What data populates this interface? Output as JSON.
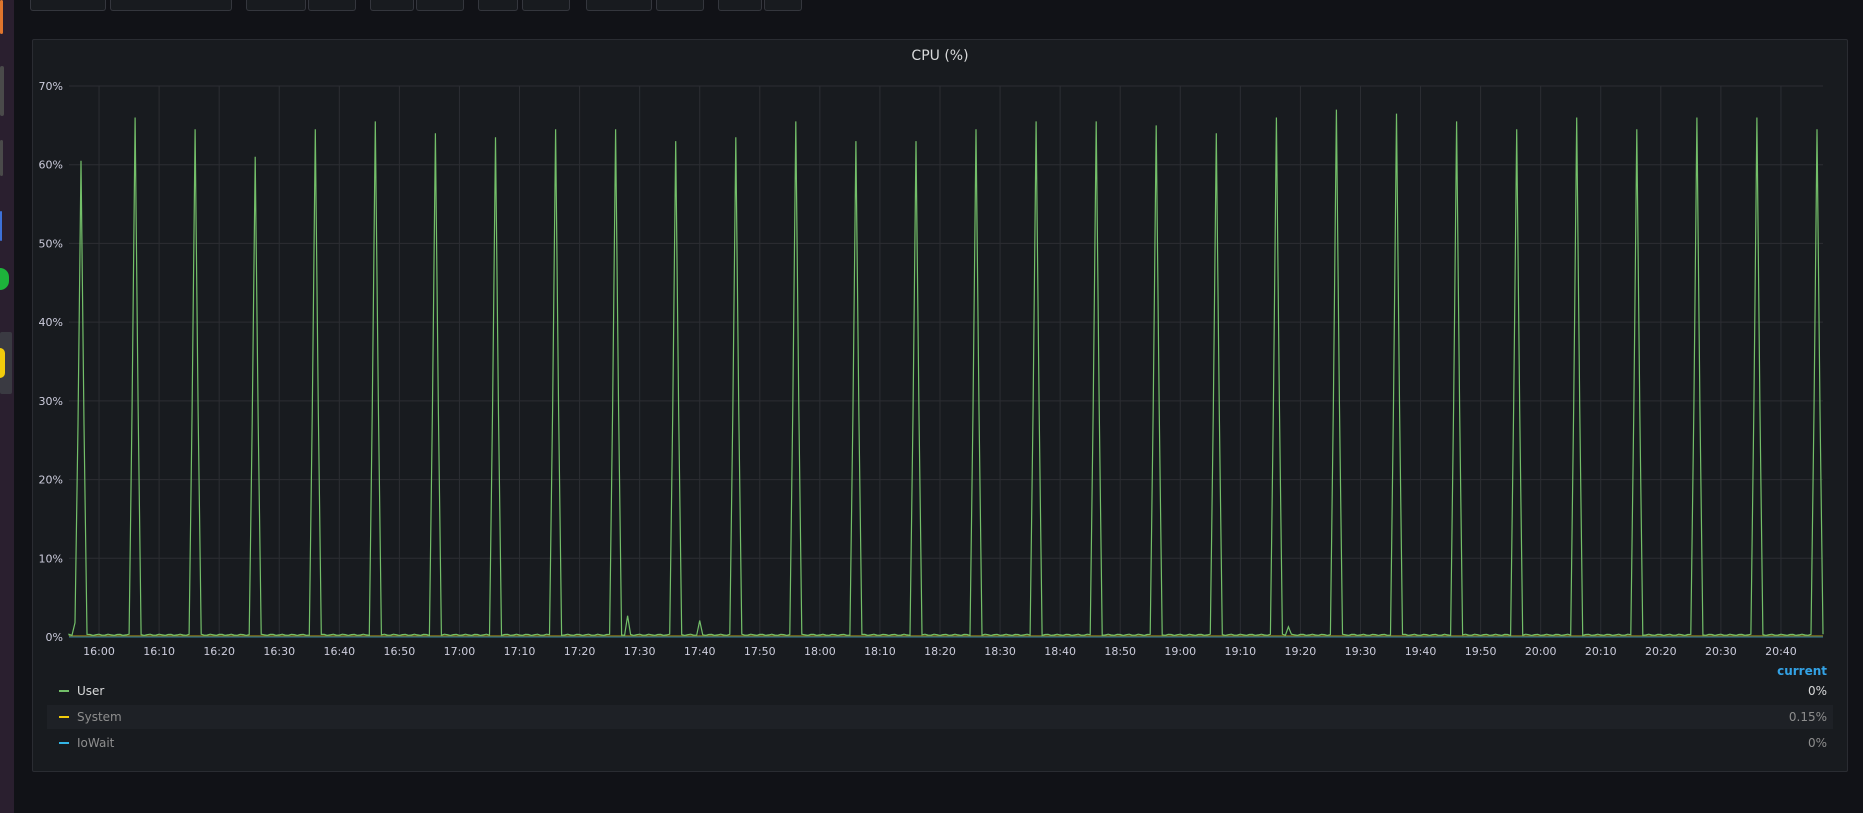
{
  "panel": {
    "title": "CPU (%)",
    "legend_header": "current"
  },
  "legend": [
    {
      "name": "User",
      "value": "0%",
      "color": "#73bf69"
    },
    {
      "name": "System",
      "value": "0.15%",
      "color": "#f2cc0c"
    },
    {
      "name": "IoWait",
      "value": "0%",
      "color": "#33b5e5"
    }
  ],
  "chart_data": {
    "type": "line",
    "title": "CPU (%)",
    "xlabel": "",
    "ylabel": "",
    "ylim": [
      0,
      70
    ],
    "y_unit": "%",
    "y_ticks": [
      "0%",
      "10%",
      "20%",
      "30%",
      "40%",
      "50%",
      "60%",
      "70%"
    ],
    "x_ticks": [
      "16:00",
      "16:10",
      "16:20",
      "16:30",
      "16:40",
      "16:50",
      "17:00",
      "17:10",
      "17:20",
      "17:30",
      "17:40",
      "17:50",
      "18:00",
      "18:10",
      "18:20",
      "18:30",
      "18:40",
      "18:50",
      "19:00",
      "19:10",
      "19:20",
      "19:30",
      "19:40",
      "19:50",
      "20:00",
      "20:10",
      "20:20",
      "20:30",
      "20:40"
    ],
    "x_range": [
      "15:55",
      "20:47"
    ],
    "grid": true,
    "legend_position": "bottom",
    "series": [
      {
        "name": "User",
        "color": "#73bf69",
        "baseline": 0.2,
        "peaks": [
          {
            "t": "15:57",
            "v": 60.5
          },
          {
            "t": "16:06",
            "v": 66.0
          },
          {
            "t": "16:16",
            "v": 64.5
          },
          {
            "t": "16:26",
            "v": 61.0
          },
          {
            "t": "16:36",
            "v": 64.5
          },
          {
            "t": "16:46",
            "v": 65.5
          },
          {
            "t": "16:56",
            "v": 64.0
          },
          {
            "t": "17:06",
            "v": 63.5
          },
          {
            "t": "17:16",
            "v": 64.5
          },
          {
            "t": "17:26",
            "v": 64.5
          },
          {
            "t": "17:36",
            "v": 63.0
          },
          {
            "t": "17:46",
            "v": 63.5
          },
          {
            "t": "17:56",
            "v": 65.5
          },
          {
            "t": "18:06",
            "v": 63.0
          },
          {
            "t": "18:16",
            "v": 63.0
          },
          {
            "t": "18:26",
            "v": 64.5
          },
          {
            "t": "18:36",
            "v": 65.5
          },
          {
            "t": "18:46",
            "v": 65.5
          },
          {
            "t": "18:56",
            "v": 65.0
          },
          {
            "t": "19:06",
            "v": 64.0
          },
          {
            "t": "19:16",
            "v": 66.0
          },
          {
            "t": "19:26",
            "v": 67.0
          },
          {
            "t": "19:36",
            "v": 66.5
          },
          {
            "t": "19:46",
            "v": 65.5
          },
          {
            "t": "19:56",
            "v": 64.5
          },
          {
            "t": "20:06",
            "v": 66.0
          },
          {
            "t": "20:16",
            "v": 64.5
          },
          {
            "t": "20:26",
            "v": 66.0
          },
          {
            "t": "20:36",
            "v": 66.0
          },
          {
            "t": "20:46",
            "v": 64.5
          }
        ],
        "small_bumps": [
          {
            "t": "15:56",
            "v": 1.8
          },
          {
            "t": "17:28",
            "v": 2.7
          },
          {
            "t": "17:40",
            "v": 2.1
          },
          {
            "t": "19:18",
            "v": 1.3
          }
        ]
      },
      {
        "name": "System",
        "color": "#f2cc0c",
        "baseline": 0.15
      },
      {
        "name": "IoWait",
        "color": "#33b5e5",
        "baseline": 0
      }
    ]
  }
}
